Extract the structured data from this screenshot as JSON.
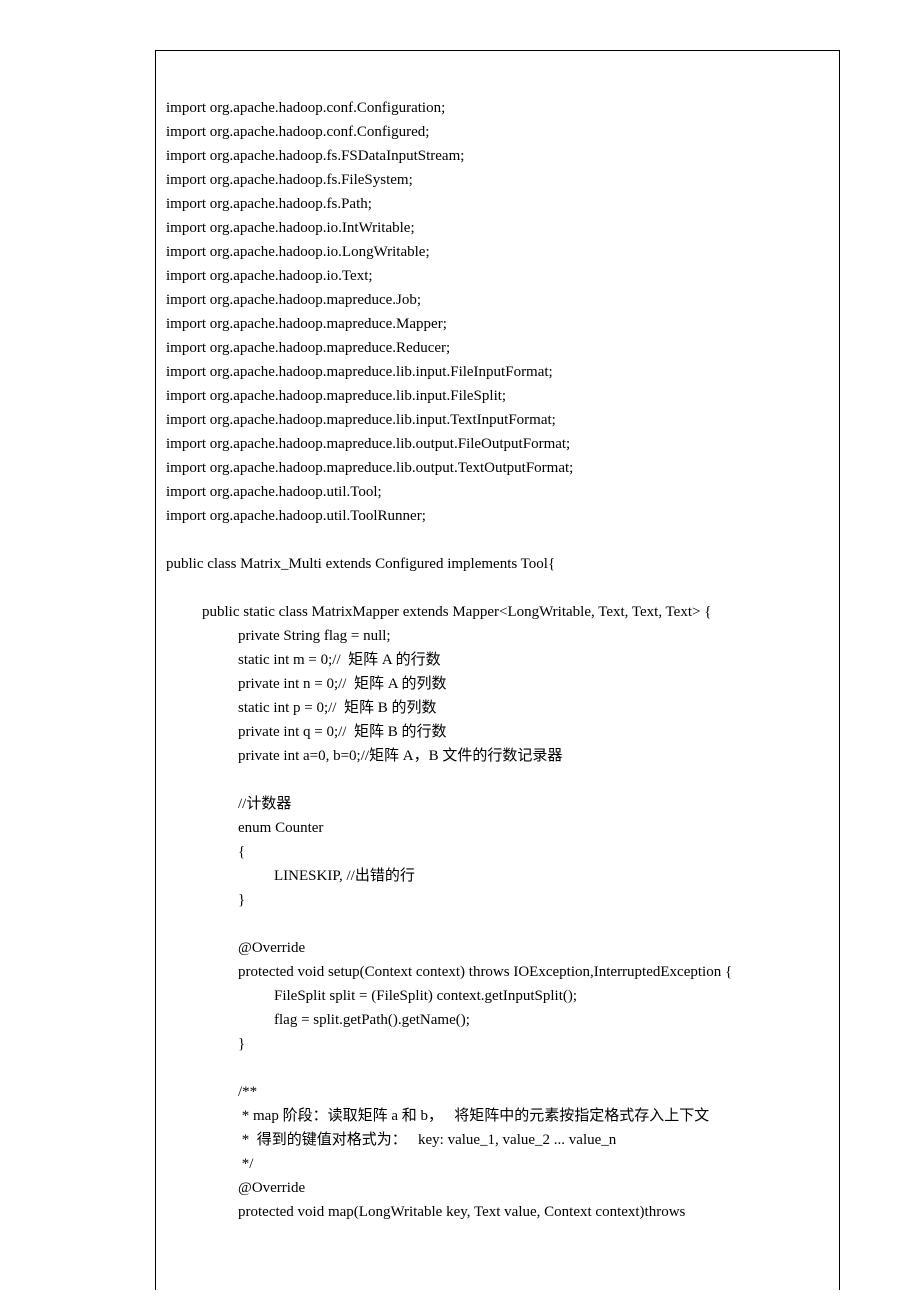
{
  "lines": [
    {
      "cls": "",
      "text": "import org.apache.hadoop.conf.Configuration;"
    },
    {
      "cls": "",
      "text": "import org.apache.hadoop.conf.Configured;"
    },
    {
      "cls": "",
      "text": "import org.apache.hadoop.fs.FSDataInputStream;"
    },
    {
      "cls": "",
      "text": "import org.apache.hadoop.fs.FileSystem;"
    },
    {
      "cls": "",
      "text": "import org.apache.hadoop.fs.Path;"
    },
    {
      "cls": "",
      "text": "import org.apache.hadoop.io.IntWritable;"
    },
    {
      "cls": "",
      "text": "import org.apache.hadoop.io.LongWritable;"
    },
    {
      "cls": "",
      "text": "import org.apache.hadoop.io.Text;"
    },
    {
      "cls": "",
      "text": "import org.apache.hadoop.mapreduce.Job;"
    },
    {
      "cls": "",
      "text": "import org.apache.hadoop.mapreduce.Mapper;"
    },
    {
      "cls": "",
      "text": "import org.apache.hadoop.mapreduce.Reducer;"
    },
    {
      "cls": "",
      "text": "import org.apache.hadoop.mapreduce.lib.input.FileInputFormat;"
    },
    {
      "cls": "",
      "text": "import org.apache.hadoop.mapreduce.lib.input.FileSplit;"
    },
    {
      "cls": "",
      "text": "import org.apache.hadoop.mapreduce.lib.input.TextInputFormat;"
    },
    {
      "cls": "",
      "text": "import org.apache.hadoop.mapreduce.lib.output.FileOutputFormat;"
    },
    {
      "cls": "",
      "text": "import org.apache.hadoop.mapreduce.lib.output.TextOutputFormat;"
    },
    {
      "cls": "",
      "text": "import org.apache.hadoop.util.Tool;"
    },
    {
      "cls": "",
      "text": "import org.apache.hadoop.util.ToolRunner;"
    },
    {
      "cls": "blank",
      "text": ""
    },
    {
      "cls": "",
      "text": "public class Matrix_Multi extends Configured implements Tool{"
    },
    {
      "cls": "blank",
      "text": ""
    },
    {
      "cls": "indent-1",
      "text": "public static class MatrixMapper extends Mapper<LongWritable, Text, Text, Text> {"
    },
    {
      "cls": "indent-2",
      "text": "private String flag = null;"
    },
    {
      "cls": "indent-2",
      "text": "static int m = 0;//  矩阵 A 的行数"
    },
    {
      "cls": "indent-2",
      "text": "private int n = 0;//  矩阵 A 的列数"
    },
    {
      "cls": "indent-2",
      "text": "static int p = 0;//  矩阵 B 的列数"
    },
    {
      "cls": "indent-2",
      "text": "private int q = 0;//  矩阵 B 的行数"
    },
    {
      "cls": "indent-2",
      "text": "private int a=0, b=0;//矩阵 A，B 文件的行数记录器"
    },
    {
      "cls": "blank",
      "text": ""
    },
    {
      "cls": "indent-2",
      "text": "//计数器"
    },
    {
      "cls": "indent-2",
      "text": "enum Counter"
    },
    {
      "cls": "indent-2",
      "text": "{"
    },
    {
      "cls": "indent-3",
      "text": "LINESKIP, //出错的行"
    },
    {
      "cls": "indent-2",
      "text": "}"
    },
    {
      "cls": "blank",
      "text": ""
    },
    {
      "cls": "indent-2",
      "text": "@Override"
    },
    {
      "cls": "indent-2",
      "text": "protected void setup(Context context) throws IOException,InterruptedException {"
    },
    {
      "cls": "indent-3",
      "text": "FileSplit split = (FileSplit) context.getInputSplit();"
    },
    {
      "cls": "indent-3",
      "text": "flag = split.getPath().getName();"
    },
    {
      "cls": "indent-2",
      "text": "}"
    },
    {
      "cls": "blank",
      "text": ""
    },
    {
      "cls": "indent-2",
      "text": "/**"
    },
    {
      "cls": "indent-2",
      "text": " * map 阶段：读取矩阵 a 和 b，   将矩阵中的元素按指定格式存入上下文"
    },
    {
      "cls": "indent-2",
      "text": " *  得到的键值对格式为：   key: value_1, value_2 ... value_n"
    },
    {
      "cls": "indent-2",
      "text": " */"
    },
    {
      "cls": "indent-2",
      "text": "@Override"
    },
    {
      "cls": "indent-2",
      "text": "protected void map(LongWritable key, Text value, Context context)throws"
    }
  ]
}
